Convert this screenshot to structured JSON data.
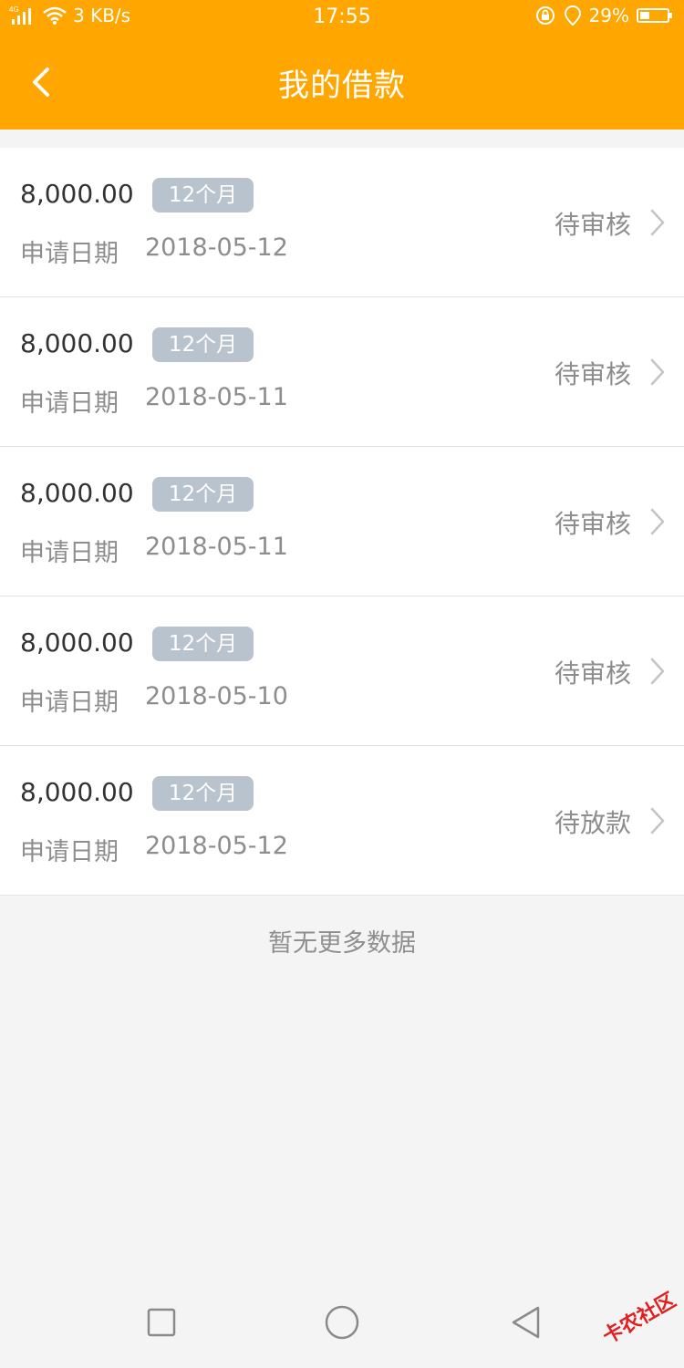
{
  "status_bar": {
    "network": "4G",
    "speed": "3 KB/s",
    "time": "17:55",
    "battery": "29%",
    "icons": [
      "signal-icon",
      "wifi-icon",
      "rotation-lock-icon",
      "location-icon",
      "battery-icon"
    ]
  },
  "header": {
    "title": "我的借款",
    "back_icon": "back-arrow-icon",
    "background": "#ffa600"
  },
  "loans": [
    {
      "amount": "8,000.00",
      "term": "12个月",
      "date_label": "申请日期",
      "date": "2018-05-12",
      "status": "待审核"
    },
    {
      "amount": "8,000.00",
      "term": "12个月",
      "date_label": "申请日期",
      "date": "2018-05-11",
      "status": "待审核"
    },
    {
      "amount": "8,000.00",
      "term": "12个月",
      "date_label": "申请日期",
      "date": "2018-05-11",
      "status": "待审核"
    },
    {
      "amount": "8,000.00",
      "term": "12个月",
      "date_label": "申请日期",
      "date": "2018-05-10",
      "status": "待审核"
    },
    {
      "amount": "8,000.00",
      "term": "12个月",
      "date_label": "申请日期",
      "date": "2018-05-12",
      "status": "待放款"
    }
  ],
  "footer_text": "暂无更多数据",
  "nav_bar": {
    "icons": [
      "recent-apps-icon",
      "home-icon",
      "back-icon"
    ]
  },
  "watermark": "卡农社区",
  "colors": {
    "accent": "#ffa600",
    "badge": "#b9c3ce",
    "muted_text": "#8d8d8d"
  }
}
